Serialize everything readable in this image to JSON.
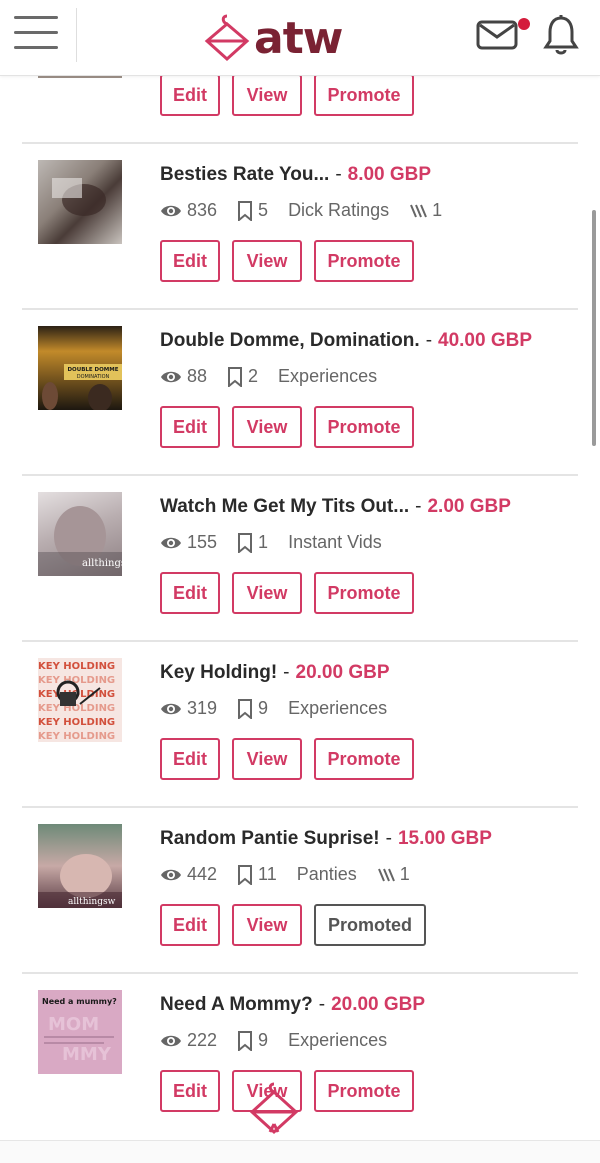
{
  "header": {
    "logo_text": "atw",
    "menu_icon": "hamburger-menu-icon",
    "mail_icon": "mail-icon",
    "bell_icon": "bell-icon",
    "notification_dot_color": "#d41c3c"
  },
  "accent_color": "#d23a64",
  "buttons": {
    "edit": "Edit",
    "view": "View",
    "promote": "Promote",
    "promoted": "Promoted"
  },
  "listings": [
    {
      "title": "Besties Rate You...",
      "price": "8.00 GBP",
      "views": "836",
      "saves": "5",
      "category": "Dick Ratings",
      "sales": "1",
      "promoted": false
    },
    {
      "title": "Double Domme, Domination.",
      "price": "40.00 GBP",
      "views": "88",
      "saves": "2",
      "category": "Experiences",
      "sales": null,
      "promoted": false,
      "thumb_text": "DOUBLE DOMME DOMINATION"
    },
    {
      "title": "Watch Me Get My Tits Out...",
      "price": "2.00 GBP",
      "views": "155",
      "saves": "1",
      "category": "Instant Vids",
      "sales": null,
      "promoted": false,
      "thumb_text": "allthings"
    },
    {
      "title": "Key Holding!",
      "price": "20.00 GBP",
      "views": "319",
      "saves": "9",
      "category": "Experiences",
      "sales": null,
      "promoted": false,
      "thumb_text": "KEY HOLDING"
    },
    {
      "title": "Random Pantie Suprise!",
      "price": "15.00 GBP",
      "views": "442",
      "saves": "11",
      "category": "Panties",
      "sales": "1",
      "promoted": true,
      "thumb_text": "allthingsw"
    },
    {
      "title": "Need A Mommy?",
      "price": "20.00 GBP",
      "views": "222",
      "saves": "9",
      "category": "Experiences",
      "sales": null,
      "promoted": false,
      "thumb_text": "Need a mummy?"
    }
  ]
}
